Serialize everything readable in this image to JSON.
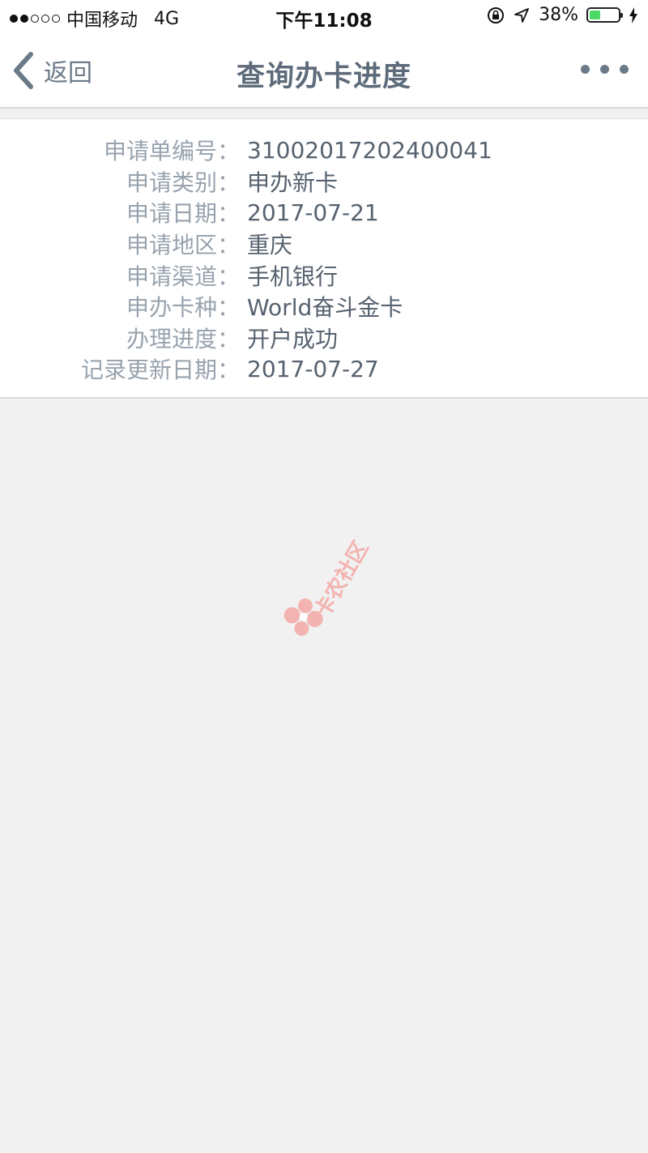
{
  "status_bar": {
    "carrier": "中国移动",
    "network": "4G",
    "time": "下午11:08",
    "battery_percent": "38%",
    "battery_level": 0.38,
    "battery_color": "#4cd964"
  },
  "nav": {
    "back_label": "返回",
    "title": "查询办卡进度",
    "more_icon": "more-dots-icon"
  },
  "details": [
    {
      "label": "申请单编号：",
      "value": "31002017202400041"
    },
    {
      "label": "申请类别：",
      "value": "申办新卡"
    },
    {
      "label": "申请日期：",
      "value": "2017-07-21"
    },
    {
      "label": "申请地区：",
      "value": "重庆"
    },
    {
      "label": "申请渠道：",
      "value": "手机银行"
    },
    {
      "label": "申办卡种：",
      "value": "World奋斗金卡"
    },
    {
      "label": "办理进度：",
      "value": "开户成功"
    },
    {
      "label": "记录更新日期：",
      "value": "2017-07-27"
    }
  ],
  "watermark": {
    "text": "卡农社区",
    "color": "#f4aaa6"
  }
}
